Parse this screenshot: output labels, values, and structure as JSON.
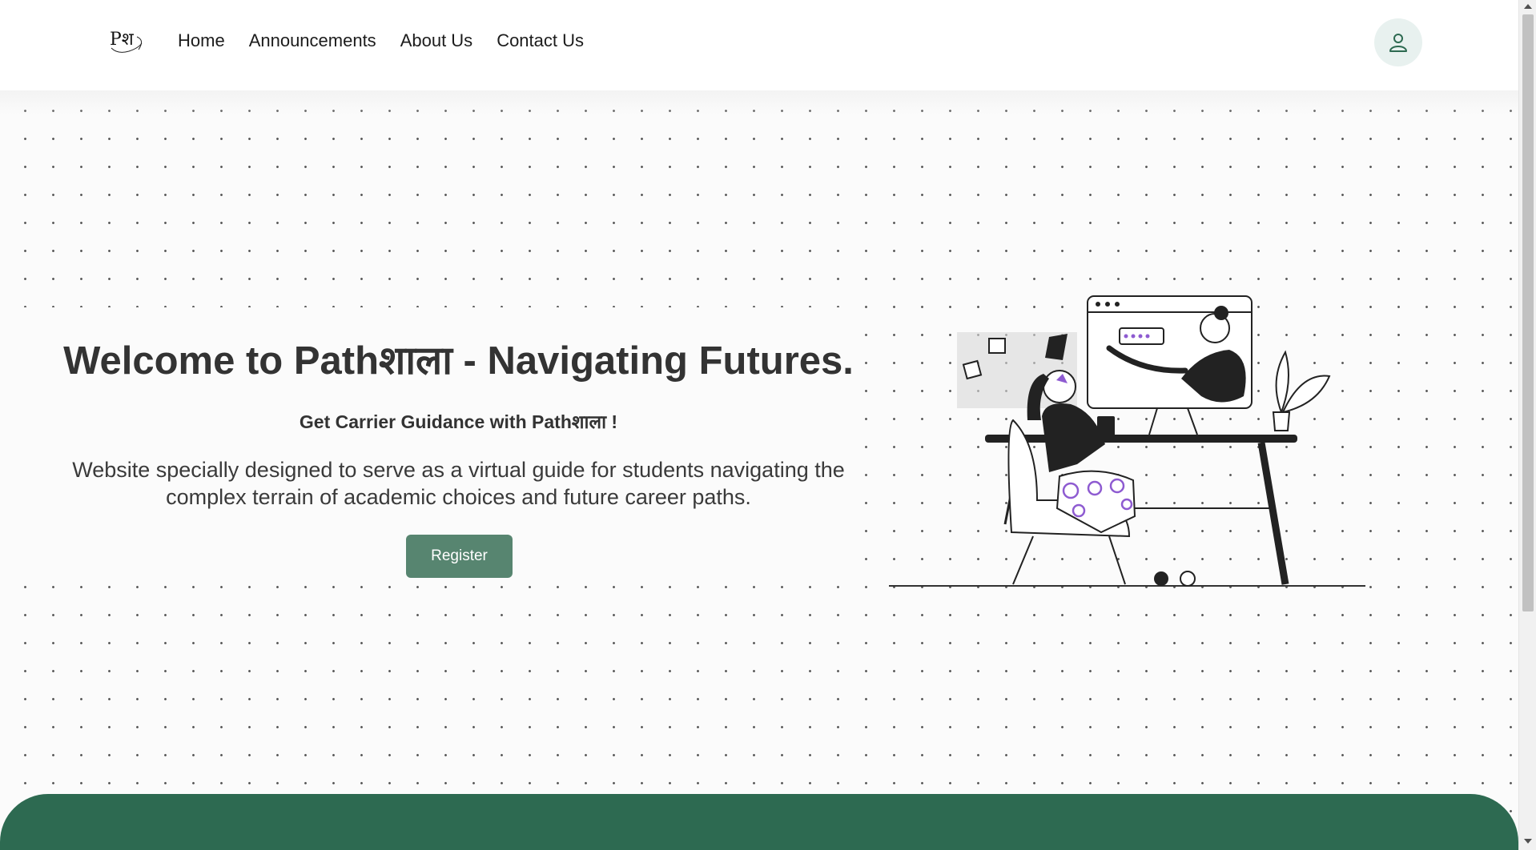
{
  "nav": {
    "logo_text": "Pश",
    "links": [
      "Home",
      "Announcements",
      "About Us",
      "Contact Us"
    ]
  },
  "hero": {
    "title": "Welcome to Pathशाला - Navigating Futures.",
    "subtitle": "Get Carrier Guidance with Pathशाला !",
    "description": "Website specially designed to serve as a virtual guide for students navigating the complex terrain of academic choices and future career paths.",
    "register_label": "Register"
  },
  "icons": {
    "profile": "user-icon",
    "illustration": "online-mentoring-illustration"
  },
  "colors": {
    "primary_green": "#2d6a51",
    "button_green": "#578570",
    "accent_purple": "#8e5bd1",
    "profile_bg": "#e8f1ef"
  }
}
